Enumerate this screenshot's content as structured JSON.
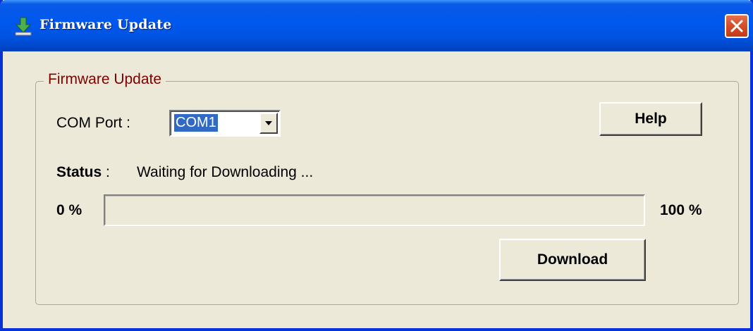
{
  "window": {
    "title": "Firmware Update",
    "app_icon": "download-arrow-icon",
    "close_icon": "close-icon"
  },
  "group": {
    "legend": "Firmware Update"
  },
  "com_port": {
    "label": "COM Port :",
    "selected": "COM1",
    "dropdown_icon": "chevron-down-icon"
  },
  "help_button": "Help",
  "status": {
    "label": "Status",
    "separator": ":",
    "text": "Waiting for Downloading ..."
  },
  "progress": {
    "min_label": "0 %",
    "max_label": "100 %",
    "value": 0
  },
  "download_button": "Download",
  "colors": {
    "titlebar": "#0054e3",
    "legend": "#800000",
    "selection": "#316ac5",
    "face": "#ece9d8",
    "close": "#d4502c"
  }
}
